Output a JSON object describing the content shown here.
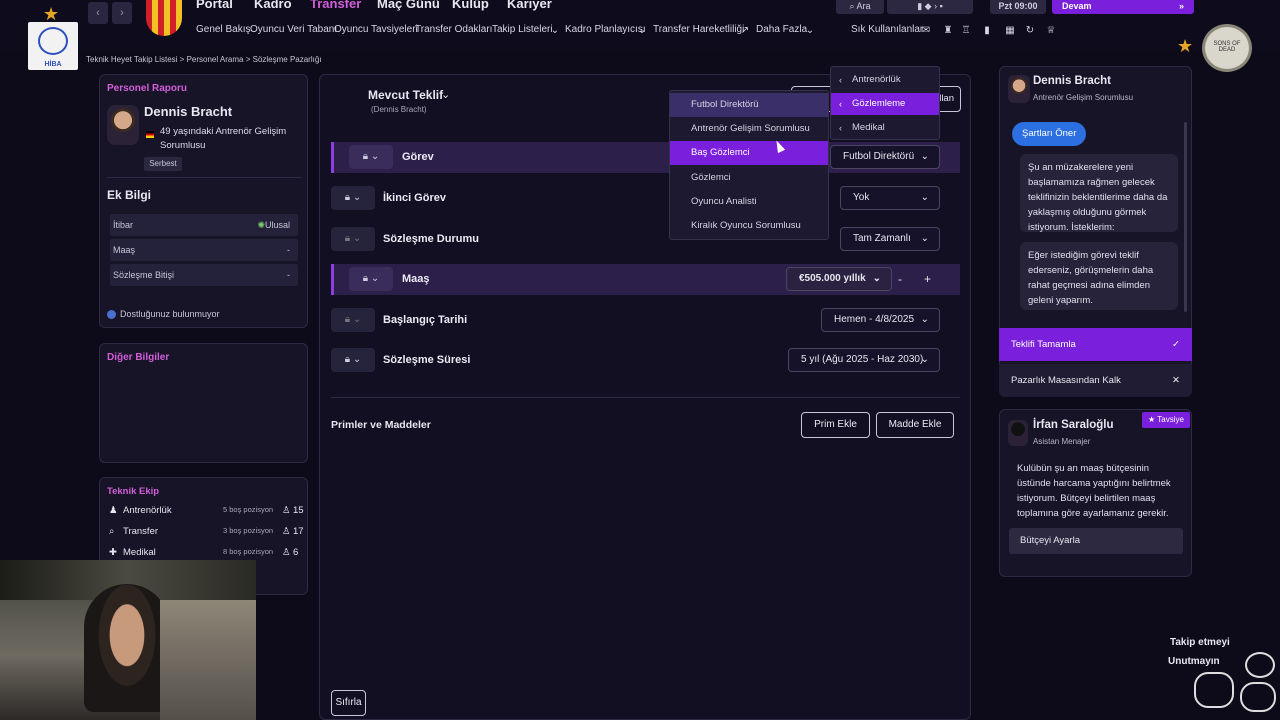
{
  "topnav": {
    "main": [
      "Portal",
      "Kadro",
      "Transfer",
      "Maç Günü",
      "Kulüp",
      "Kariyer"
    ],
    "sub": [
      "Genel Bakış",
      "Oyuncu Veri Tabanı",
      "Oyuncu Tavsiyeleri",
      "Transfer Odakları",
      "Takip Listeleri",
      "Kadro Planlayıcısı",
      "Transfer Hareketliliği",
      "Daha Fazla"
    ],
    "quick_label": "Sık Kullanılanlar",
    "date": "Pzt 09:00",
    "ara": "Ara",
    "devam": "Devam"
  },
  "breadcrumb": "Teknik Heyet Takip Listesi > Personel Arama > Sözleşme Pazarlığı",
  "personnel_report": {
    "title": "Personel Raporu",
    "name": "Dennis Bracht",
    "desc": "49 yaşındaki Antrenör Gelişim Sorumlusu",
    "status": "Serbest"
  },
  "extra_info": {
    "title": "Ek Bilgi",
    "rows": [
      {
        "label": "İtibar",
        "value": "Ulusal"
      },
      {
        "label": "Maaş",
        "value": "-"
      },
      {
        "label": "Sözleşme Bitişi",
        "value": "-"
      }
    ],
    "friend_note": "Dostluğunuz bulunmuyor"
  },
  "other_info": {
    "title": "Diğer Bilgiler"
  },
  "tech_staff": {
    "title": "Teknik Ekip",
    "rows": [
      {
        "label": "Antrenörlük",
        "open": "5 boş pozisyon",
        "count": "15"
      },
      {
        "label": "Transfer",
        "open": "3 boş pozisyon",
        "count": "17"
      },
      {
        "label": "Medikal",
        "open": "8 boş pozisyon",
        "count": "6"
      }
    ]
  },
  "contract": {
    "header": "Mevcut Teklif",
    "header_sub": "(Dennis Bracht)",
    "header_btn": "llan",
    "rows": [
      {
        "label": "Görev",
        "value": "Futbol Direktörü"
      },
      {
        "label": "İkinci Görev",
        "value": "Yok"
      },
      {
        "label": "Sözleşme Durumu",
        "value": "Tam Zamanlı"
      },
      {
        "label": "Maaş",
        "value": "€505.000 yıllık"
      },
      {
        "label": "Başlangıç Tarihi",
        "value": "Hemen - 4/8/2025"
      },
      {
        "label": "Sözleşme Süresi",
        "value": "5 yıl (Ağu 2025 - Haz 2030)"
      }
    ],
    "bonus_title": "Primler ve Maddeler",
    "add_bonus": "Prim Ekle",
    "add_clause": "Madde Ekle",
    "reset": "Sıfırla",
    "minus": "-",
    "plus": "+"
  },
  "role_dropdown": {
    "items": [
      "Futbol Direktörü",
      "Antrenör Gelişim Sorumlusu",
      "Baş Gözlemci",
      "Gözlemci",
      "Oyuncu Analisti",
      "Kiralık Oyuncu Sorumlusu"
    ]
  },
  "category_menu": {
    "items": [
      "Antrenörlük",
      "Gözlemleme",
      "Medikal"
    ]
  },
  "chat": {
    "name": "Dennis Bracht",
    "role": "Antrenör Gelişim Sorumlusu",
    "action": "Şartları Öner",
    "message1": "Şu an müzakerelere yeni başlamamıza rağmen gelecek teklifinizin beklentilerime daha da yaklaşmış olduğunu görmek istiyorum. İsteklerim:",
    "message2": "Eğer istediğim görevi teklif ederseniz, görüşmelerin daha rahat geçmesi adına elimden geleni yaparım.",
    "complete": "Teklifi Tamamla",
    "leave": "Pazarlık Masasından Kalk"
  },
  "advisor": {
    "name": "İrfan Saraloğlu",
    "role": "Asistan Menajer",
    "badge": "Tavsiye",
    "text": "Kulübün şu an maaş bütçesinin üstünde harcama yaptığını belirtmek istiyorum. Bütçeyi belirtilen maaş toplamına göre ayarlamanız gerekir.",
    "button": "Bütçeyi Ayarla"
  },
  "overlay": {
    "follow_line1": "Takip etmeyi",
    "follow_line2": "Unutmayın",
    "logo_left": "HİBA",
    "logo_right": "SONS OF DEAD"
  },
  "colors": {
    "accent": "#7a1fdb",
    "pink": "#d25ed9",
    "bg": "#0d0b1a"
  }
}
